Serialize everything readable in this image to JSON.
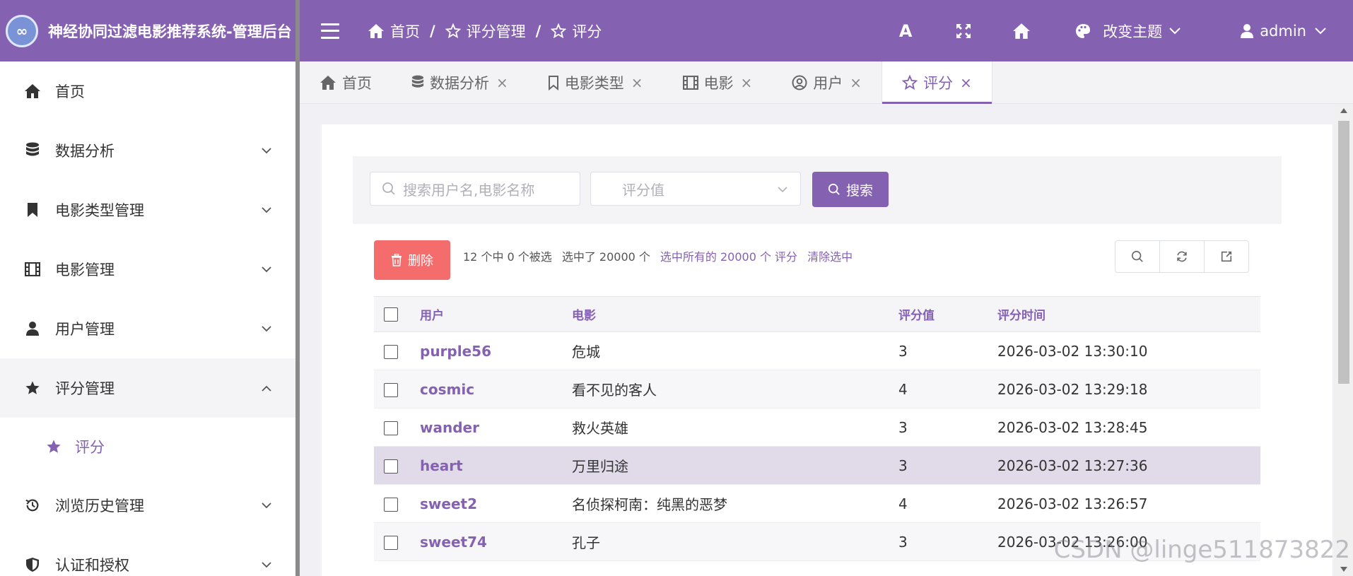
{
  "app": {
    "title": "神经协同过滤电影推荐系统-管理后台"
  },
  "colors": {
    "primary": "#8561b1",
    "danger": "#f56c6c"
  },
  "sidebar": {
    "items": [
      {
        "label": "首页",
        "icon": "home-icon"
      },
      {
        "label": "数据分析",
        "icon": "database-icon"
      },
      {
        "label": "电影类型管理",
        "icon": "bookmark-icon"
      },
      {
        "label": "电影管理",
        "icon": "film-icon"
      },
      {
        "label": "用户管理",
        "icon": "user-icon"
      },
      {
        "label": "评分管理",
        "icon": "star-icon"
      },
      {
        "label": "浏览历史管理",
        "icon": "history-icon"
      },
      {
        "label": "认证和授权",
        "icon": "shield-icon"
      }
    ],
    "submenu": {
      "label": "评分"
    }
  },
  "header": {
    "breadcrumb": [
      "首页",
      "评分管理",
      "评分"
    ],
    "separator": "/",
    "theme_label": "改变主题",
    "user": "admin",
    "font_tool": "A"
  },
  "tabs": [
    {
      "label": "首页"
    },
    {
      "label": "数据分析"
    },
    {
      "label": "电影类型"
    },
    {
      "label": "电影"
    },
    {
      "label": "用户"
    },
    {
      "label": "评分",
      "active": true
    }
  ],
  "tab_close": "×",
  "filters": {
    "search_placeholder": "搜索用户名,电影名称",
    "rating_placeholder": "评分值",
    "search_button": "搜索"
  },
  "actions": {
    "delete": "删除",
    "selection_count": "12 个中 0 个被选",
    "selected_total": "选中了 20000 个",
    "select_all": "选中所有的 20000 个 评分",
    "clear": "清除选中"
  },
  "table": {
    "headers": [
      "用户",
      "电影",
      "评分值",
      "评分时间"
    ],
    "rows": [
      {
        "user": "purple56",
        "movie": "危城",
        "score": "3",
        "time": "2026-03-02 13:30:10"
      },
      {
        "user": "cosmic",
        "movie": "看不见的客人",
        "score": "4",
        "time": "2026-03-02 13:29:18"
      },
      {
        "user": "wander",
        "movie": "救火英雄",
        "score": "3",
        "time": "2026-03-02 13:28:45"
      },
      {
        "user": "heart",
        "movie": "万里归途",
        "score": "3",
        "time": "2026-03-02 13:27:36"
      },
      {
        "user": "sweet2",
        "movie": "名侦探柯南：纯黑的恶梦",
        "score": "4",
        "time": "2026-03-02 13:26:57"
      },
      {
        "user": "sweet74",
        "movie": "孔子",
        "score": "3",
        "time": "2026-03-02 13:26:00"
      }
    ]
  },
  "watermark": "CSDN @linge511873822"
}
